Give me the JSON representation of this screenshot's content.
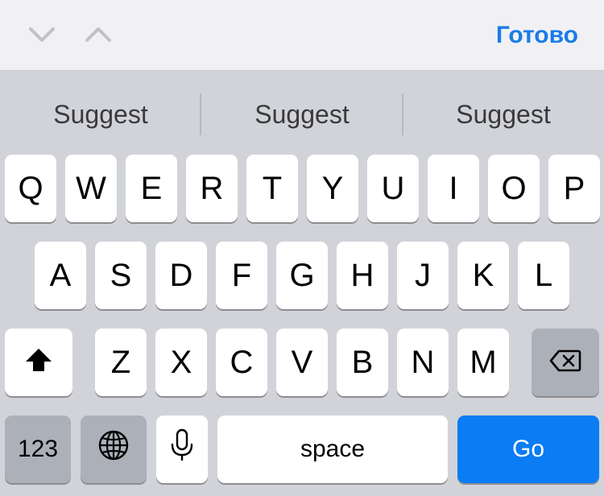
{
  "toolbar": {
    "prev_icon": "chevron-down-icon",
    "next_icon": "chevron-up-icon",
    "done_label": "Готово",
    "done_color": "#1a7ce8"
  },
  "suggestions": [
    "Suggest",
    "Suggest",
    "Suggest"
  ],
  "rows": {
    "row1": [
      "Q",
      "W",
      "E",
      "R",
      "T",
      "Y",
      "U",
      "I",
      "O",
      "P"
    ],
    "row2": [
      "A",
      "S",
      "D",
      "F",
      "G",
      "H",
      "J",
      "K",
      "L"
    ],
    "row3": [
      "Z",
      "X",
      "C",
      "V",
      "B",
      "N",
      "M"
    ]
  },
  "keys": {
    "shift_icon": "shift-arrow-icon",
    "delete_icon": "backspace-icon",
    "numbers_label": "123",
    "globe_icon": "globe-icon",
    "mic_icon": "microphone-icon",
    "space_label": "space",
    "go_label": "Go"
  },
  "colors": {
    "keyboard_bg": "#d1d3d9",
    "key_bg": "#ffffff",
    "function_key_bg": "#acb1b9",
    "go_key_bg": "#0a7cf4"
  }
}
